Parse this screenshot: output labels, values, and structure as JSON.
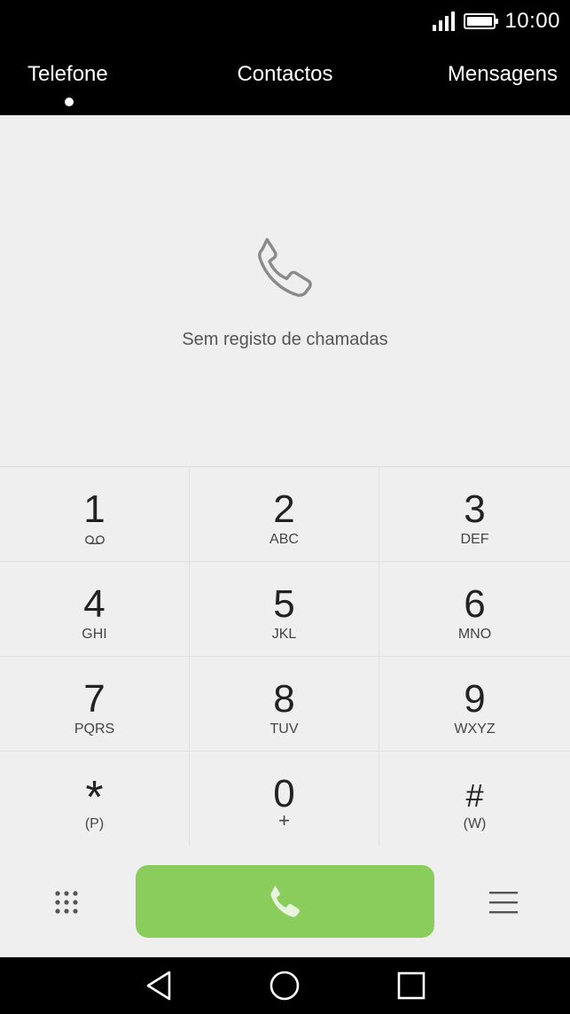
{
  "status_bar": {
    "time": "10:00"
  },
  "tabs": [
    {
      "label": "Telefone"
    },
    {
      "label": "Contactos"
    },
    {
      "label": "Mensagens"
    }
  ],
  "call_log": {
    "empty_message": "Sem registo de chamadas"
  },
  "keypad": {
    "keys": [
      {
        "digit": "1",
        "letters": ""
      },
      {
        "digit": "2",
        "letters": "ABC"
      },
      {
        "digit": "3",
        "letters": "DEF"
      },
      {
        "digit": "4",
        "letters": "GHI"
      },
      {
        "digit": "5",
        "letters": "JKL"
      },
      {
        "digit": "6",
        "letters": "MNO"
      },
      {
        "digit": "7",
        "letters": "PQRS"
      },
      {
        "digit": "8",
        "letters": "TUV"
      },
      {
        "digit": "9",
        "letters": "WXYZ"
      },
      {
        "digit": "*",
        "letters": "(P)"
      },
      {
        "digit": "0",
        "letters": "+"
      },
      {
        "digit": "#",
        "letters": "(W)"
      }
    ]
  },
  "icons": {
    "signal": "signal-icon",
    "battery": "battery-icon",
    "empty_state": "phone-handset-icon",
    "voicemail": "voicemail-icon",
    "dialpad": "dialpad-grid-icon",
    "call": "call-icon",
    "menu": "menu-icon",
    "back": "nav-back-icon",
    "home": "nav-home-icon",
    "recent": "nav-recent-apps-icon"
  },
  "colors": {
    "call_button": "#8bcd5c",
    "background": "#efefef",
    "bar_background": "#000000",
    "text": "#222222"
  }
}
